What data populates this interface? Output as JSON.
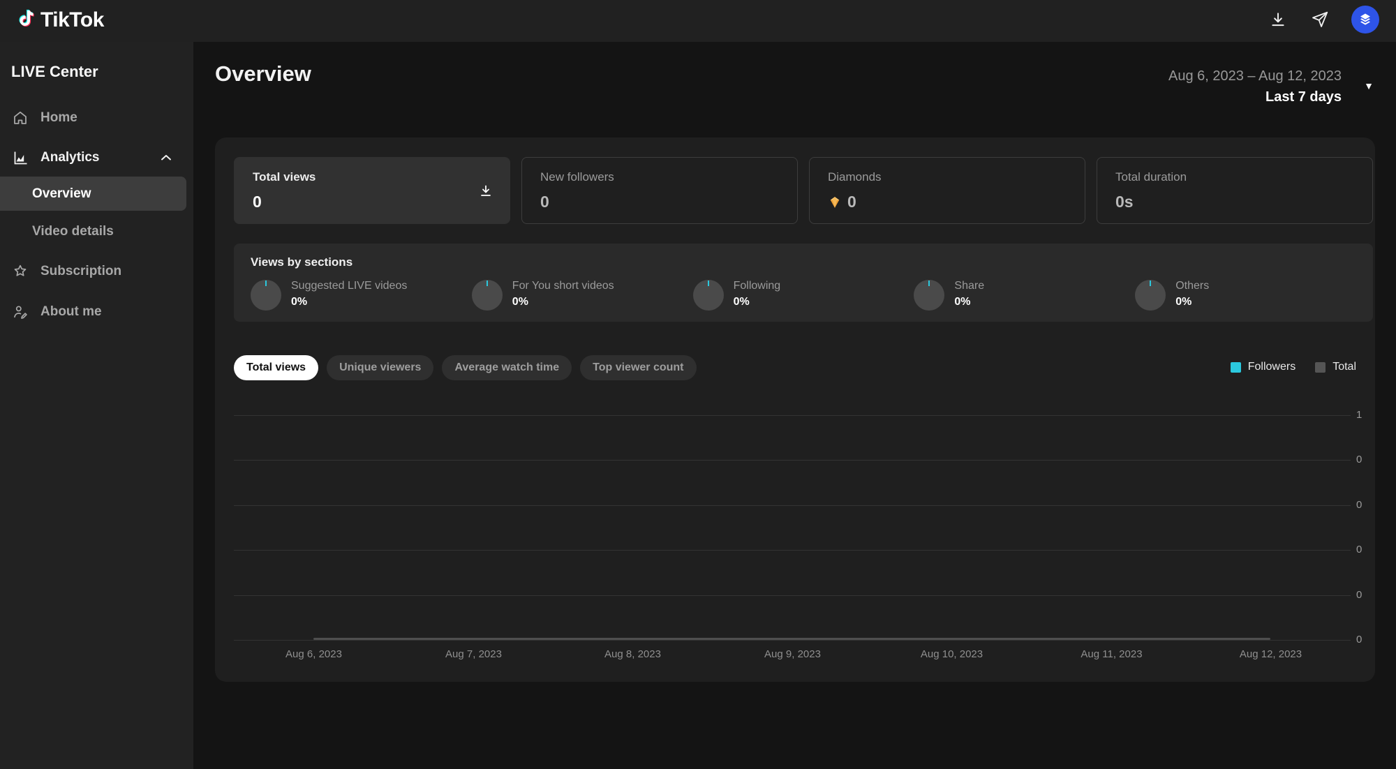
{
  "app": {
    "logo_text": "TikTok",
    "product_title": "LIVE Center"
  },
  "topbar": {
    "icons": [
      "download-icon",
      "send-icon",
      "avatar-layers-icon"
    ],
    "avatar_color": "#2e54e8"
  },
  "sidebar": {
    "items": [
      {
        "label": "Home"
      },
      {
        "label": "Analytics"
      },
      {
        "label": "Overview"
      },
      {
        "label": "Video details"
      },
      {
        "label": "Subscription"
      },
      {
        "label": "About me"
      }
    ],
    "active_item": "Overview",
    "expanded_section": "Analytics"
  },
  "header": {
    "title": "Overview",
    "date_range": "Aug 6, 2023 – Aug 12, 2023",
    "range_label": "Last 7 days"
  },
  "stats": {
    "cards": [
      {
        "label": "Total views",
        "value": "0",
        "selected": true
      },
      {
        "label": "New followers",
        "value": "0"
      },
      {
        "label": "Diamonds",
        "value": "0",
        "icon": "diamond-icon"
      },
      {
        "label": "Total duration",
        "value": "0s"
      }
    ]
  },
  "sections": {
    "title": "Views by sections",
    "items": [
      {
        "label": "Suggested LIVE videos",
        "value": "0%"
      },
      {
        "label": "For You short videos",
        "value": "0%"
      },
      {
        "label": "Following",
        "value": "0%"
      },
      {
        "label": "Share",
        "value": "0%"
      },
      {
        "label": "Others",
        "value": "0%"
      }
    ]
  },
  "tabs": {
    "items": [
      {
        "label": "Total views",
        "active": true
      },
      {
        "label": "Unique viewers"
      },
      {
        "label": "Average watch time"
      },
      {
        "label": "Top viewer count"
      }
    ]
  },
  "legend": {
    "followers": "Followers",
    "followers_color": "#2bc8de",
    "total": "Total",
    "total_color": "#555555"
  },
  "chart_data": {
    "type": "line",
    "title": "Total views",
    "x": [
      "Aug 6, 2023",
      "Aug 7, 2023",
      "Aug 8, 2023",
      "Aug 9, 2023",
      "Aug 10, 2023",
      "Aug 11, 2023",
      "Aug 12, 2023"
    ],
    "series": [
      {
        "name": "Followers",
        "color": "#2bc8de",
        "values": [
          0,
          0,
          0,
          0,
          0,
          0,
          0
        ]
      },
      {
        "name": "Total",
        "color": "#555555",
        "values": [
          0,
          0,
          0,
          0,
          0,
          0,
          0
        ]
      }
    ],
    "y_ticks_top_to_bottom": [
      "1",
      "0",
      "0",
      "0",
      "0",
      "0"
    ],
    "ylim": [
      0,
      1
    ],
    "grid": true,
    "legend_position": "top-right",
    "xlabel": "",
    "ylabel": ""
  }
}
